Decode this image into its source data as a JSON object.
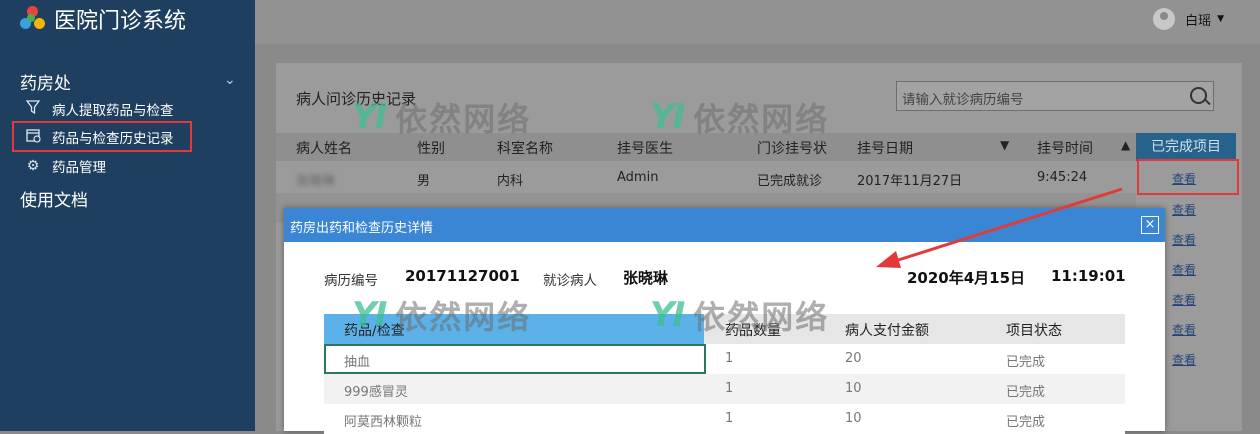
{
  "app": {
    "title": "医院门诊系统",
    "user": "白瑶"
  },
  "sidebar": {
    "section1": "药房处",
    "items": [
      {
        "label": "病人提取药品与检查",
        "icon": "filter-icon"
      },
      {
        "label": "药品与检查历史记录",
        "icon": "calendar-icon"
      },
      {
        "label": "药品管理",
        "icon": "gear-icon"
      }
    ],
    "section2": "使用文档"
  },
  "panel": {
    "title": "病人问诊历史记录",
    "search_placeholder": "请输入就诊病历编号",
    "columns": [
      "病人姓名",
      "性别",
      "科室名称",
      "挂号医生",
      "门诊挂号状",
      "挂号日期",
      "挂号时间",
      "已完成项目"
    ],
    "rows": [
      {
        "name": "张晓琳",
        "gender": "男",
        "dept": "内科",
        "doctor": "Admin",
        "status": "已完成就诊",
        "date": "2017年11月27日",
        "time": "9:45:24",
        "action": "查看"
      }
    ],
    "view_labels": [
      "查看",
      "查看",
      "查看",
      "查看",
      "查看",
      "查看",
      "查看"
    ]
  },
  "dialog": {
    "title": "药房出药和检查历史详情",
    "record_label": "病历编号",
    "record_no": "20171127001",
    "patient_label": "就诊病人",
    "patient": "张晓琳",
    "date": "2020年4月15日",
    "time": "11:19:01",
    "columns": [
      "药品/检查",
      "药品数量",
      "病人支付金额",
      "项目状态"
    ],
    "rows": [
      {
        "item": "抽血",
        "qty": "1",
        "amount": "20",
        "status": "已完成"
      },
      {
        "item": "999感冒灵",
        "qty": "1",
        "amount": "10",
        "status": "已完成"
      },
      {
        "item": "阿莫西林颗粒",
        "qty": "1",
        "amount": "10",
        "status": "已完成"
      }
    ]
  },
  "watermark": "依然网络",
  "colors": {
    "sidebar": "#1f3f60",
    "dialog_header": "#3a86d4",
    "table_header": "#5cb2e8",
    "highlight": "#e23a3a"
  }
}
